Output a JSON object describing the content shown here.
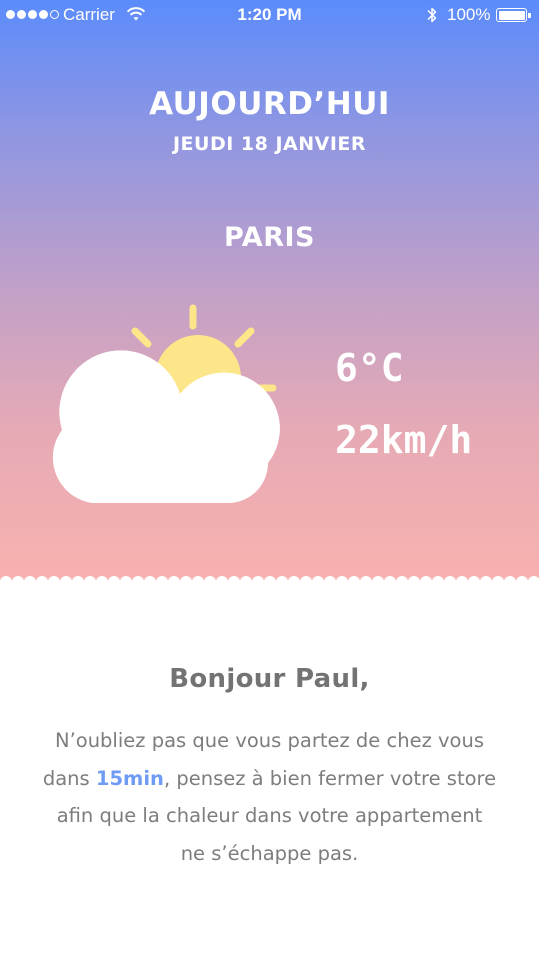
{
  "status_bar": {
    "carrier": "Carrier",
    "time": "1:20 PM",
    "battery": "100%",
    "signal_bars_filled": 4,
    "signal_bars_total": 5
  },
  "header": {
    "title": "AUJOURD’HUI",
    "date": "JEUDI 18 JANVIER",
    "city": "PARIS"
  },
  "weather": {
    "icon": "partly-cloudy-icon",
    "temperature": "6°C",
    "wind": "22km/h"
  },
  "message": {
    "greeting": "Bonjour Paul,",
    "line1": "N’oubliez pas que vous partez de chez vous",
    "line2_before": "dans ",
    "line2_highlight": "15min",
    "line2_after": ", pensez à bien fermer votre store",
    "line3": "afin que la chaleur dans votre appartement",
    "line4": "ne s’échappe pas."
  },
  "colors": {
    "gradient_top": "#5b8cfb",
    "gradient_bottom": "#fbb2ae",
    "sun": "#fde68a",
    "cloud": "#ffffff",
    "text_gray": "#7d7d7d",
    "accent_blue": "#6f9bf5"
  }
}
